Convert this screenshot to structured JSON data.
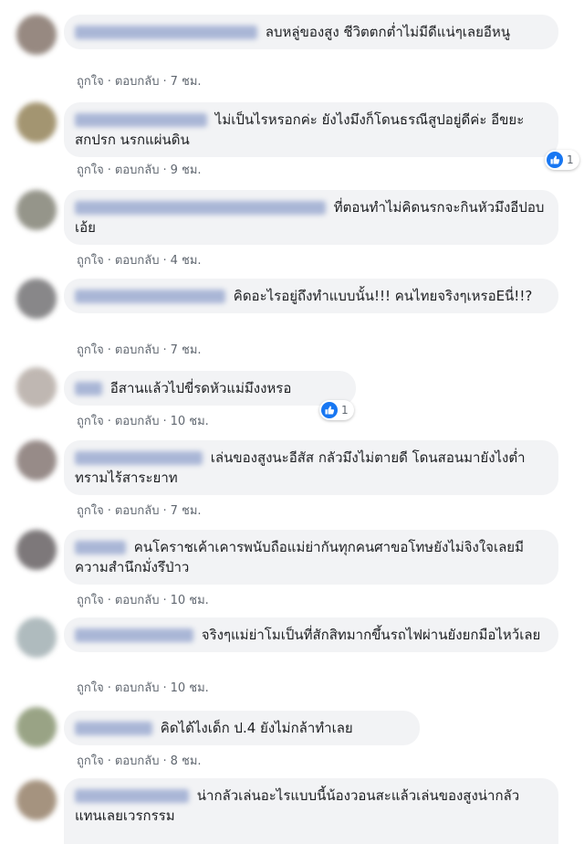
{
  "comments": [
    {
      "text": "ลบหลู่ของสูง ชีวิตตกต่ำไม่มีดีแน่ๆเลยอีหนู",
      "time": "7 ชม.",
      "avatar_color": "#8c7d74"
    },
    {
      "text": "ไม่เป็นไรหรอกค่ะ ยังไงมึงก็โดนธรณีสูปอยู่ดีค่ะ อีขยะสกปรก นรกแผ่นดิน",
      "time": "9 ชม.",
      "reaction_count": "1",
      "avatar_color": "#9a8a62"
    },
    {
      "text": "ที่ตอนทำไม่คิดนรกจะกินหัวมึงอีปอบเอ้ย",
      "time": "4 ชม.",
      "avatar_color": "#8a8a7e"
    },
    {
      "text": "คิดอะไรอยู่ถึงทำแบบนั้น!!! คนไทยจริงๆเหรอEนี่!!?",
      "time": "7 ชม.",
      "avatar_color": "#7c7b7d"
    },
    {
      "text": "อีสานแล้วไปขี่รดหัวแม่มึงงหรอ",
      "time": "10 ชม.",
      "reaction_count": "1",
      "avatar_color": "#b9b0aa"
    },
    {
      "text": "เล่นของสูงนะอีสัส กลัวมึงไม่ตายดี โดนสอนมายังไงต่ำทรามไร้สาระยาท",
      "time": "7 ชม.",
      "avatar_color": "#8c7f7c"
    },
    {
      "text": "คนโคราชเค้าเคารพนับถือแม่ย่ากันทุกคนศาขอโทษยังไม่จิงใจเลยมีความสำนึกมั่งรึป่าว",
      "time": "10 ชม.",
      "avatar_color": "#6f6a6c"
    },
    {
      "text": "จริงๆแม่ย่าโมเป็นที่สักสิทมากขึ้นรถไฟผ่านยังยกมือไหว้เลย",
      "time": "10 ชม.",
      "avatar_color": "#a7b4b7"
    },
    {
      "text": "คิดได้ไงเด็ก ป.4 ยังไม่กล้าทำเลย",
      "time": "8 ชม.",
      "avatar_color": "#8e9a78"
    },
    {
      "text": "น่ากลัวเล่นอะไรแบบนี้น้องวอนสะแล้วเล่นของสูงน่ากลัวแทนเลยเวรกรรม",
      "time": "",
      "avatar_color": "#9c8872"
    }
  ],
  "labels": {
    "like": "ถูกใจ",
    "reply": "ตอบกลับ",
    "dot": "·"
  }
}
